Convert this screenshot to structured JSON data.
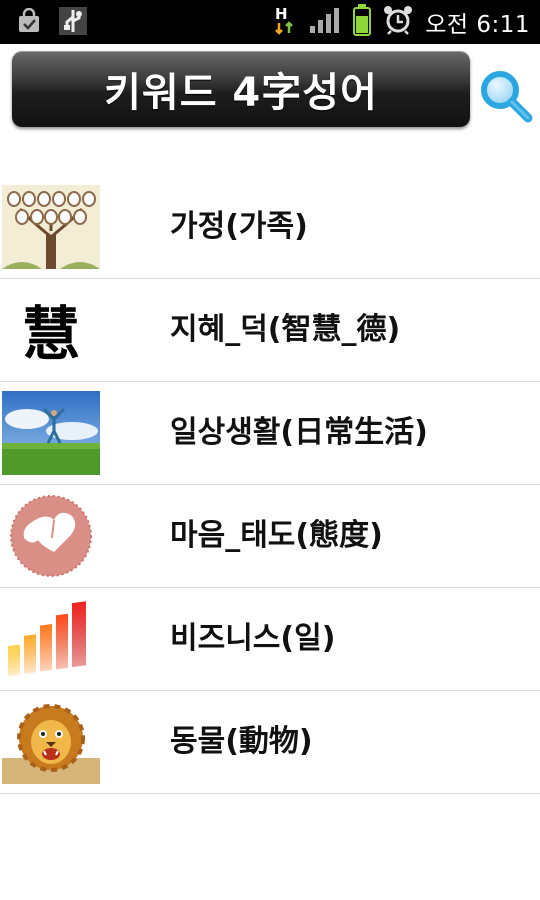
{
  "status_bar": {
    "time": "오전 6:11",
    "left_icons": [
      "shopping-bag-icon",
      "usb-debug-icon"
    ],
    "right_icons": [
      "h-data-icon",
      "signal-icon",
      "battery-icon",
      "alarm-icon"
    ]
  },
  "header": {
    "title": "키워드 4字성어",
    "search_icon": "search-icon"
  },
  "categories": [
    {
      "label": "가정(가족)",
      "icon": "family-tree-icon"
    },
    {
      "label": "지혜_덕(智慧_德)",
      "icon": "calligraphy-hye-icon",
      "glyph": "慧"
    },
    {
      "label": "일상생활(日常生活)",
      "icon": "person-jumping-field-icon"
    },
    {
      "label": "마음_태도(態度)",
      "icon": "heart-hand-icon"
    },
    {
      "label": "비즈니스(일)",
      "icon": "bar-chart-icon"
    },
    {
      "label": "동물(動物)",
      "icon": "lion-icon"
    }
  ],
  "colors": {
    "title_bar_dark": "#1e1e1e",
    "search_blue": "#2aa6e0",
    "divider": "#dcdcdc"
  }
}
